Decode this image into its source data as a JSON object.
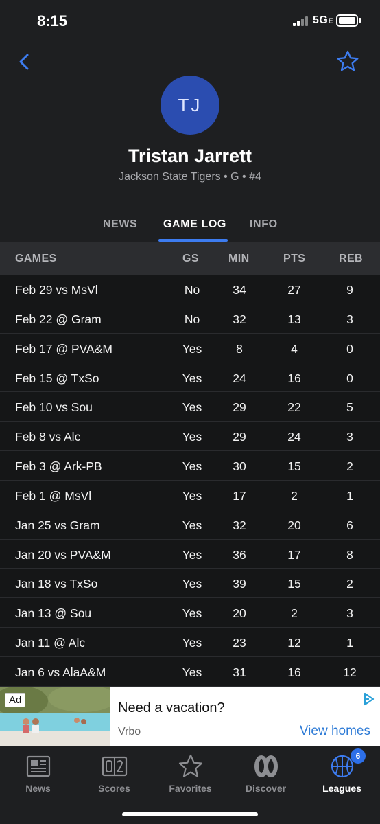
{
  "status": {
    "time": "8:15",
    "network": "5G",
    "network_suffix": "E"
  },
  "player": {
    "initials": "TJ",
    "name": "Tristan Jarrett",
    "meta": "Jackson State Tigers • G • #4"
  },
  "tabs": [
    {
      "label": "NEWS",
      "active": false
    },
    {
      "label": "GAME LOG",
      "active": true
    },
    {
      "label": "INFO",
      "active": false
    }
  ],
  "table": {
    "headers": [
      "GAMES",
      "GS",
      "MIN",
      "PTS",
      "REB"
    ],
    "rows": [
      [
        "Feb 29 vs MsVl",
        "No",
        "34",
        "27",
        "9"
      ],
      [
        "Feb 22 @ Gram",
        "No",
        "32",
        "13",
        "3"
      ],
      [
        "Feb 17 @ PVA&M",
        "Yes",
        "8",
        "4",
        "0"
      ],
      [
        "Feb 15 @ TxSo",
        "Yes",
        "24",
        "16",
        "0"
      ],
      [
        "Feb 10 vs Sou",
        "Yes",
        "29",
        "22",
        "5"
      ],
      [
        "Feb 8 vs Alc",
        "Yes",
        "29",
        "24",
        "3"
      ],
      [
        "Feb 3 @ Ark-PB",
        "Yes",
        "30",
        "15",
        "2"
      ],
      [
        "Feb 1 @ MsVl",
        "Yes",
        "17",
        "2",
        "1"
      ],
      [
        "Jan 25 vs Gram",
        "Yes",
        "32",
        "20",
        "6"
      ],
      [
        "Jan 20 vs PVA&M",
        "Yes",
        "36",
        "17",
        "8"
      ],
      [
        "Jan 18 vs TxSo",
        "Yes",
        "39",
        "15",
        "2"
      ],
      [
        "Jan 13 @ Sou",
        "Yes",
        "20",
        "2",
        "3"
      ],
      [
        "Jan 11 @ Alc",
        "Yes",
        "23",
        "12",
        "1"
      ],
      [
        "Jan 6 vs AlaA&M",
        "Yes",
        "31",
        "16",
        "12"
      ]
    ]
  },
  "ad": {
    "badge": "Ad",
    "headline": "Need a vacation?",
    "advertiser": "Vrbo",
    "cta": "View homes"
  },
  "tabbar": {
    "items": [
      {
        "label": "News",
        "icon": "newspaper-icon",
        "active": false
      },
      {
        "label": "Scores",
        "icon": "scoreboard-icon",
        "active": false
      },
      {
        "label": "Favorites",
        "icon": "star-icon",
        "active": false
      },
      {
        "label": "Discover",
        "icon": "discover-icon",
        "active": false
      },
      {
        "label": "Leagues",
        "icon": "basketball-icon",
        "active": true
      }
    ],
    "leagues_badge": "6"
  },
  "colors": {
    "accent": "#3d7cf0",
    "avatar": "#2b4db0",
    "background": "#1e1f21",
    "row": "#151617"
  }
}
